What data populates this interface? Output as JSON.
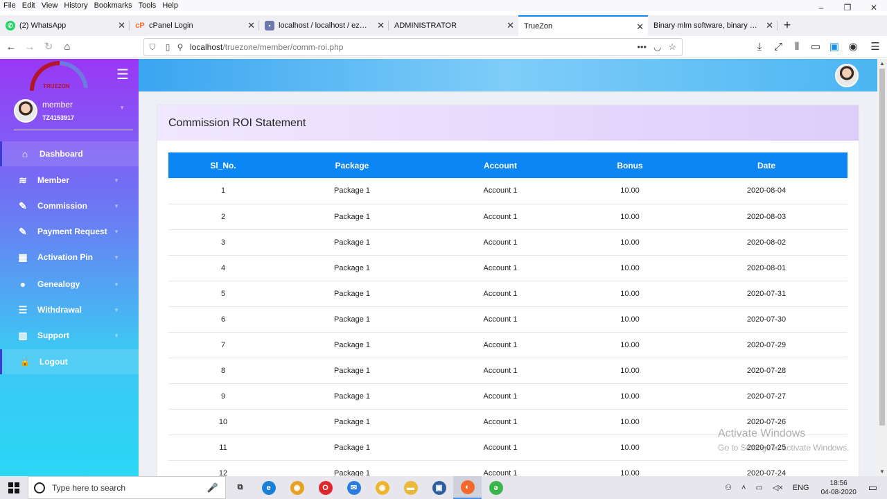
{
  "browser": {
    "menu": [
      "File",
      "Edit",
      "View",
      "History",
      "Bookmarks",
      "Tools",
      "Help"
    ],
    "tabs": [
      {
        "label": "(2) WhatsApp",
        "icon": "whatsapp-icon",
        "color": "#25d366"
      },
      {
        "label": "cPanel Login",
        "icon": "cpanel-icon",
        "color": "#ff6c2c"
      },
      {
        "label": "localhost / localhost / ezzyeam",
        "icon": "phpmyadmin-icon",
        "color": "#6c78af"
      },
      {
        "label": "ADMINISTRATOR",
        "icon": "",
        "color": ""
      },
      {
        "label": "TrueZon",
        "icon": "",
        "color": "",
        "active": true
      },
      {
        "label": "Binary mlm software, binary mlm sc",
        "icon": "",
        "color": ""
      }
    ],
    "url_host": "localhost",
    "url_path": "/truezone/member/comm-roi.php"
  },
  "sidebar": {
    "logo_text": "TRUEZON",
    "profile": {
      "name": "member",
      "id": "TZ4153917"
    },
    "items": [
      {
        "label": "Dashboard",
        "icon": "home-icon",
        "glyph": "⌂",
        "caret": false
      },
      {
        "label": "Member",
        "icon": "layers-icon",
        "glyph": "≋",
        "caret": true
      },
      {
        "label": "Commission",
        "icon": "edit-icon",
        "glyph": "✎",
        "caret": true
      },
      {
        "label": "Payment Request",
        "icon": "edit-icon",
        "glyph": "✎",
        "caret": true
      },
      {
        "label": "Activation Pin",
        "icon": "grid-icon",
        "glyph": "▦",
        "caret": true
      },
      {
        "label": "Genealogy",
        "icon": "user-icon",
        "glyph": "●",
        "caret": true
      },
      {
        "label": "Withdrawal",
        "icon": "list-icon",
        "glyph": "☰",
        "caret": true
      },
      {
        "label": "Support",
        "icon": "bar-chart-icon",
        "glyph": "▥",
        "caret": true
      },
      {
        "label": "Logout",
        "icon": "lock-icon",
        "glyph": "🔒",
        "caret": false
      }
    ]
  },
  "page": {
    "title": "Commission ROI Statement",
    "columns": [
      "Sl_No.",
      "Package",
      "Account",
      "Bonus",
      "Date"
    ],
    "rows": [
      [
        "1",
        "Package 1",
        "Account 1",
        "10.00",
        "2020-08-04"
      ],
      [
        "2",
        "Package 1",
        "Account 1",
        "10.00",
        "2020-08-03"
      ],
      [
        "3",
        "Package 1",
        "Account 1",
        "10.00",
        "2020-08-02"
      ],
      [
        "4",
        "Package 1",
        "Account 1",
        "10.00",
        "2020-08-01"
      ],
      [
        "5",
        "Package 1",
        "Account 1",
        "10.00",
        "2020-07-31"
      ],
      [
        "6",
        "Package 1",
        "Account 1",
        "10.00",
        "2020-07-30"
      ],
      [
        "7",
        "Package 1",
        "Account 1",
        "10.00",
        "2020-07-29"
      ],
      [
        "8",
        "Package 1",
        "Account 1",
        "10.00",
        "2020-07-28"
      ],
      [
        "9",
        "Package 1",
        "Account 1",
        "10.00",
        "2020-07-27"
      ],
      [
        "10",
        "Package 1",
        "Account 1",
        "10.00",
        "2020-07-26"
      ],
      [
        "11",
        "Package 1",
        "Account 1",
        "10.00",
        "2020-07-25"
      ],
      [
        "12",
        "Package 1",
        "Account 1",
        "10.00",
        "2020-07-24"
      ]
    ]
  },
  "watermark": {
    "line1": "Activate Windows",
    "line2": "Go to Settings to activate Windows."
  },
  "taskbar": {
    "search_placeholder": "Type here to search",
    "apps": [
      {
        "name": "task-view-icon",
        "glyph": "⧉",
        "color": "#333"
      },
      {
        "name": "edge-icon",
        "glyph": "e",
        "color": "#1b7fd8"
      },
      {
        "name": "chrome-icon",
        "glyph": "◉",
        "color": "#e8a020"
      },
      {
        "name": "opera-icon",
        "glyph": "O",
        "color": "#e0262c"
      },
      {
        "name": "mail-icon",
        "glyph": "✉",
        "color": "#2d7de0"
      },
      {
        "name": "chrome-canary-icon",
        "glyph": "◉",
        "color": "#f1b42f"
      },
      {
        "name": "file-explorer-icon",
        "glyph": "▬",
        "color": "#e8b93a"
      },
      {
        "name": "store-icon",
        "glyph": "▣",
        "color": "#2d5f9e"
      },
      {
        "name": "firefox-icon",
        "glyph": "◐",
        "color": "#f1692d",
        "active": true
      },
      {
        "name": "app-green-icon",
        "glyph": "ə",
        "color": "#3ab54a"
      }
    ],
    "language": "ENG",
    "time": "18:56",
    "date": "04-08-2020"
  }
}
